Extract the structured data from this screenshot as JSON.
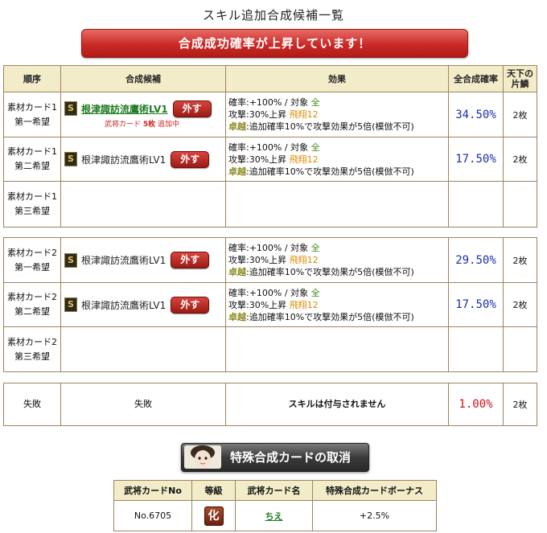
{
  "title": "スキル追加合成候補一覧",
  "banner": "合成成功確率が上昇しています！",
  "headers": {
    "order": "順序",
    "candidate": "合成候補",
    "effect": "効果",
    "total_rate": "全合成確率",
    "tenka": "天下の片鱗"
  },
  "effect_text": {
    "line1a": "確率:+100% / 対象 ",
    "line1b": "全",
    "line2a": "攻撃:30%上昇 ",
    "line2b": "飛翔12",
    "line3a": "卓越",
    "line3b": ":追加確率10%で攻撃効果が5倍(模倣不可)"
  },
  "group1": [
    {
      "order1": "素材カード1",
      "order2": "第一希望",
      "skill": "根津諏訪流鷹術LV1",
      "remove": "外す",
      "note_pre": "武将カード ",
      "note_num": "5枚",
      "note_post": " 追加中",
      "rate": "34.50%",
      "count": "2枚"
    },
    {
      "order1": "素材カード1",
      "order2": "第二希望",
      "skill": "根津諏訪流鷹術LV1",
      "remove": "外す",
      "rate": "17.50%",
      "count": "2枚"
    },
    {
      "order1": "素材カード1",
      "order2": "第三希望"
    }
  ],
  "group2": [
    {
      "order1": "素材カード2",
      "order2": "第一希望",
      "skill": "根津諏訪流鷹術LV1",
      "remove": "外す",
      "rate": "29.50%",
      "count": "2枚"
    },
    {
      "order1": "素材カード2",
      "order2": "第二希望",
      "skill": "根津諏訪流鷹術LV1",
      "remove": "外す",
      "rate": "17.50%",
      "count": "2枚"
    },
    {
      "order1": "素材カード2",
      "order2": "第三希望"
    }
  ],
  "fail_row": {
    "order": "失敗",
    "candidate": "失敗",
    "effect": "スキルは付与されません",
    "rate": "1.00%",
    "count": "2枚"
  },
  "special_button": "特殊合成カードの取消",
  "bottom_table": {
    "headers": [
      "武将カードNo",
      "等級",
      "武将カード名",
      "特殊合成カードボーナス"
    ],
    "row": {
      "card_no": "No.6705",
      "grade": "化",
      "name": "ちえ",
      "bonus": "+2.5%"
    }
  },
  "colors": {
    "banner_red": "#c92a26",
    "header_bg": "#f3ecc9",
    "rate_blue": "#1a2fa8",
    "rate_red": "#cc1111",
    "skill_green": "#1f7a1f"
  }
}
